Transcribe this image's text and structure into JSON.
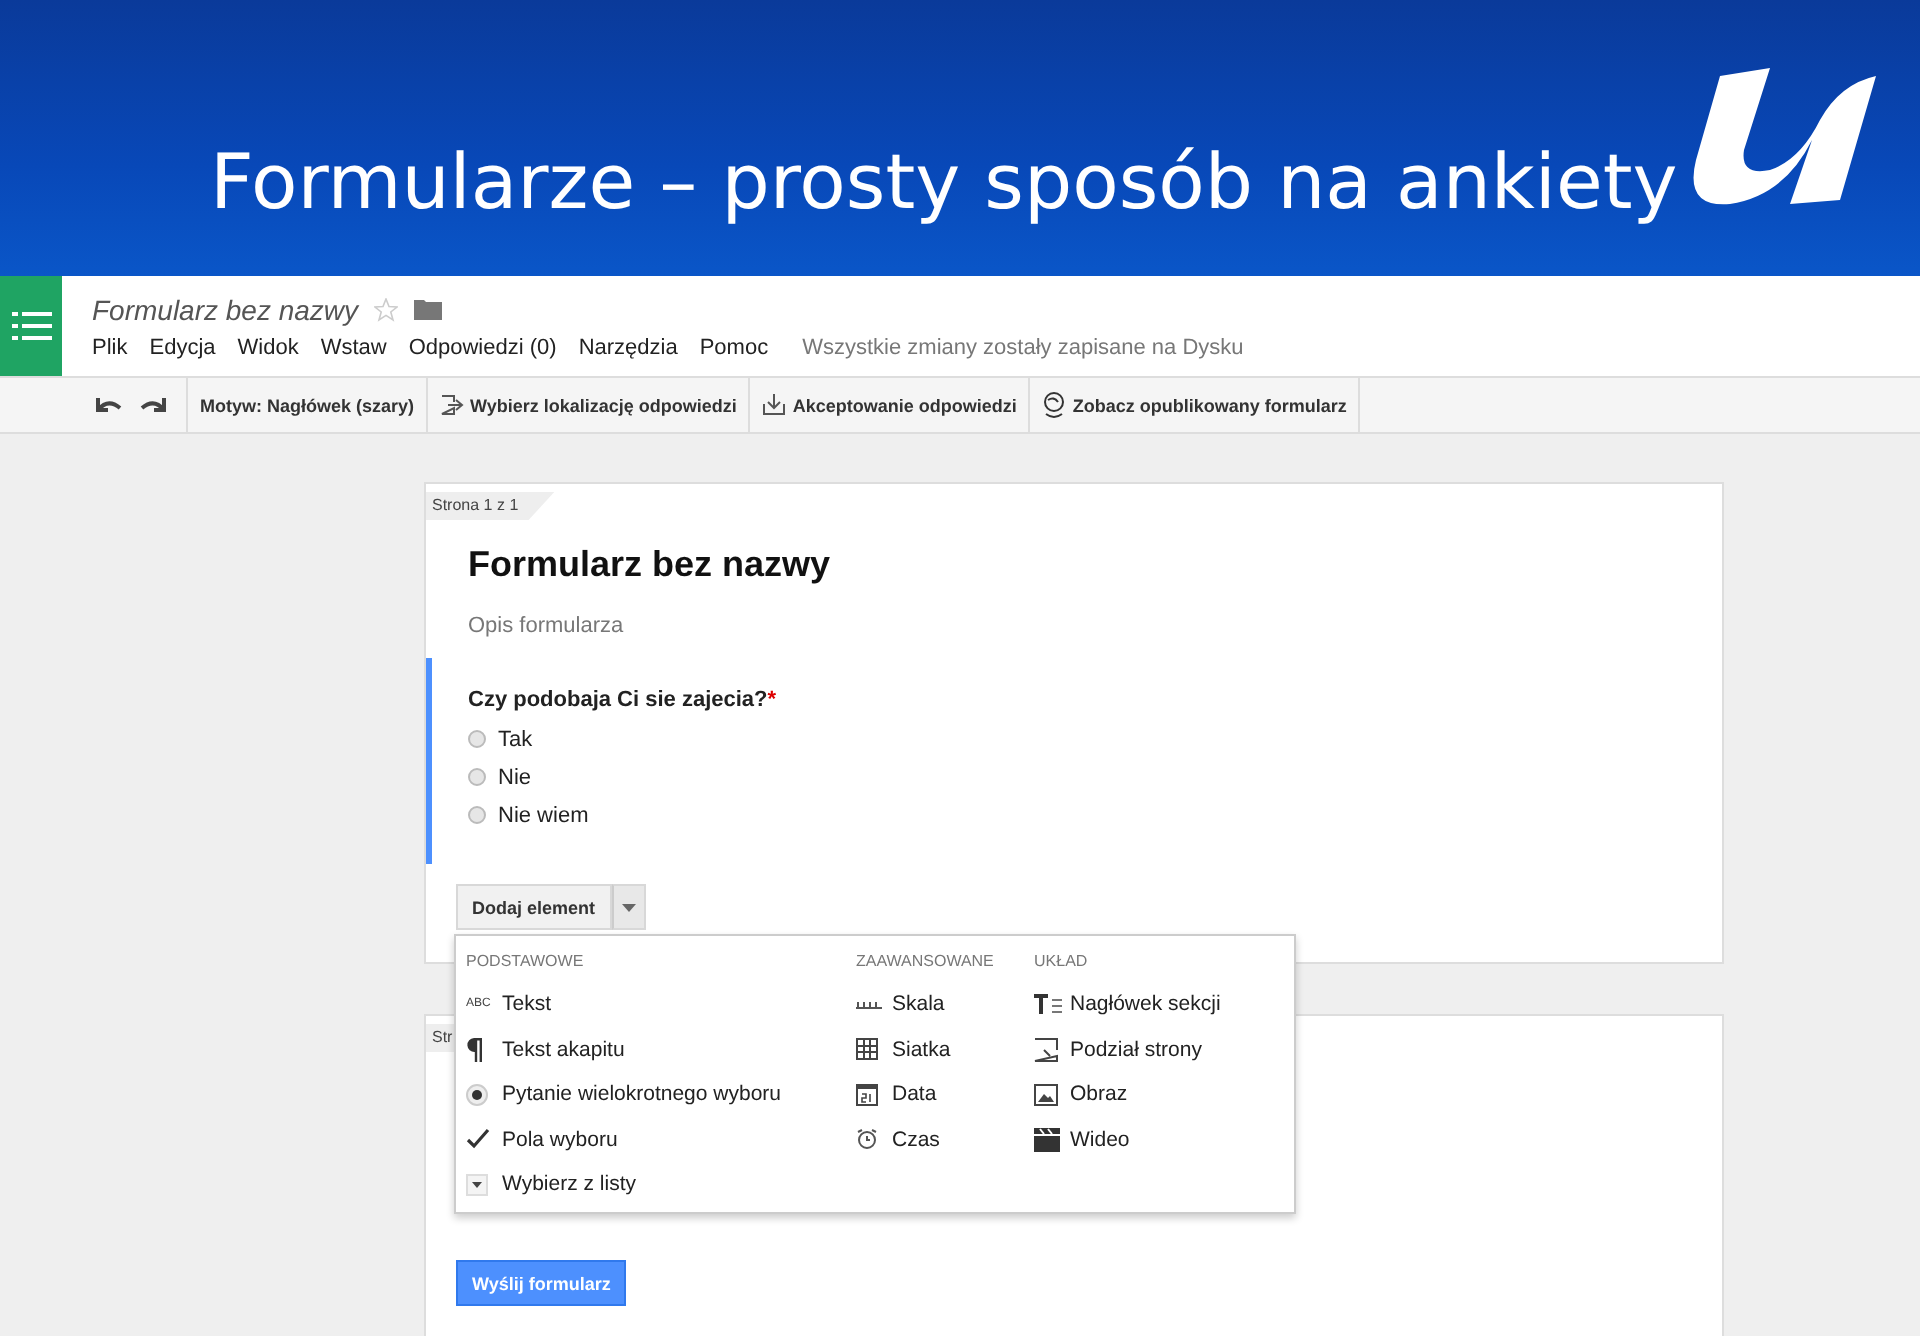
{
  "slide": {
    "title": "Formularze – prosty sposób na ankiety"
  },
  "app": {
    "doc_title": "Formularz bez nazwy",
    "starred": false,
    "menu": [
      "Plik",
      "Edycja",
      "Widok",
      "Wstaw",
      "Odpowiedzi (0)",
      "Narzędzia",
      "Pomoc"
    ],
    "save_status": "Wszystkie zmiany zostały zapisane na Dysku"
  },
  "toolbar": [
    {
      "kind": "theme",
      "label": "Motyw: Nagłówek (szary)"
    },
    {
      "kind": "destination",
      "label": "Wybierz lokalizację odpowiedzi"
    },
    {
      "kind": "accepting",
      "label": "Akceptowanie odpowiedzi"
    },
    {
      "kind": "published",
      "label": "Zobacz opublikowany formularz"
    }
  ],
  "form": {
    "page_label": "Strona 1 z 1",
    "title": "Formularz bez nazwy",
    "description_placeholder": "Opis formularza",
    "question": {
      "text": "Czy podobaja Ci sie zajecia?",
      "required_mark": "*",
      "options": [
        {
          "label": "Tak",
          "selected": false
        },
        {
          "label": "Nie",
          "selected": false
        },
        {
          "label": "Nie wiem",
          "selected": false
        }
      ]
    },
    "add_button": "Dodaj element"
  },
  "add_menu": [
    {
      "heading": "PODSTAWOWE",
      "items": [
        {
          "kind": "text",
          "icon_text": "ABC",
          "label": "Tekst"
        },
        {
          "kind": "paragraph",
          "label": "Tekst akapitu"
        },
        {
          "kind": "radio",
          "label": "Pytanie wielokrotnego wyboru"
        },
        {
          "kind": "check",
          "label": "Pola wyboru"
        },
        {
          "kind": "list",
          "label": "Wybierz z listy"
        }
      ]
    },
    {
      "heading": "ZAAWANSOWANE",
      "items": [
        {
          "kind": "scale",
          "label": "Skala"
        },
        {
          "kind": "grid",
          "label": "Siatka"
        },
        {
          "kind": "date",
          "label": "Data"
        },
        {
          "kind": "time",
          "label": "Czas"
        }
      ]
    },
    {
      "heading": "UKŁAD",
      "items": [
        {
          "kind": "header",
          "label": "Nagłówek sekcji"
        },
        {
          "kind": "pagebreak",
          "label": "Podział strony"
        },
        {
          "kind": "image",
          "label": "Obraz"
        },
        {
          "kind": "video",
          "label": "Wideo"
        }
      ]
    }
  ],
  "page2": {
    "page_label": "Str",
    "submit": "Wyślij formularz"
  }
}
